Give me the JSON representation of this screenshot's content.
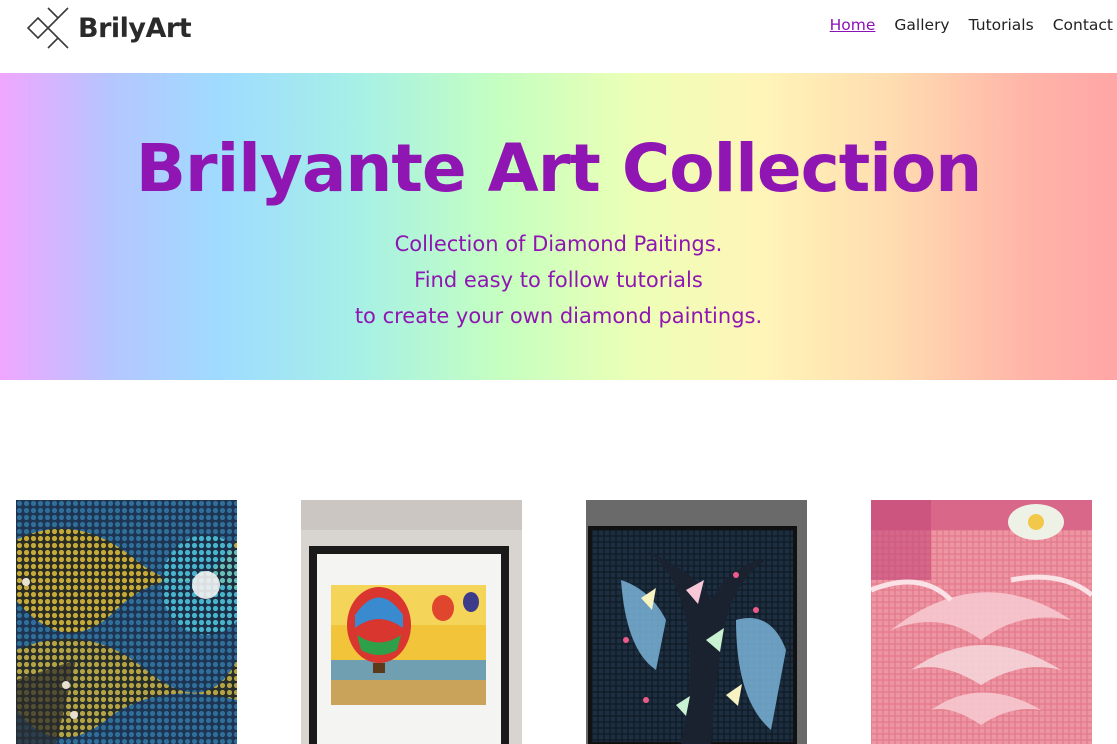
{
  "header": {
    "logo_text": "BrilyArt",
    "logo_icon": "diamond-cross-logo-icon",
    "nav": [
      {
        "label": "Home",
        "active": true
      },
      {
        "label": "Gallery",
        "active": false
      },
      {
        "label": "Tutorials",
        "active": false
      },
      {
        "label": "Contact",
        "active": false
      }
    ]
  },
  "hero": {
    "title": "Brilyante Art Collection",
    "subtitle_lines": [
      "Collection of Diamond Paitings.",
      "Find easy to follow tutorials",
      "to create your own diamond paintings."
    ]
  },
  "gallery": {
    "items": [
      {
        "image": "blue-yellow-diamond-mosaic-image"
      },
      {
        "image": "framed-hot-air-balloons-image"
      },
      {
        "image": "butterfly-tree-diamond-painting-image"
      },
      {
        "image": "pink-peony-diamond-painting-image"
      }
    ]
  },
  "colors": {
    "accent": "#8f16b3",
    "nav_active": "#8a12b8",
    "text": "#222222"
  }
}
